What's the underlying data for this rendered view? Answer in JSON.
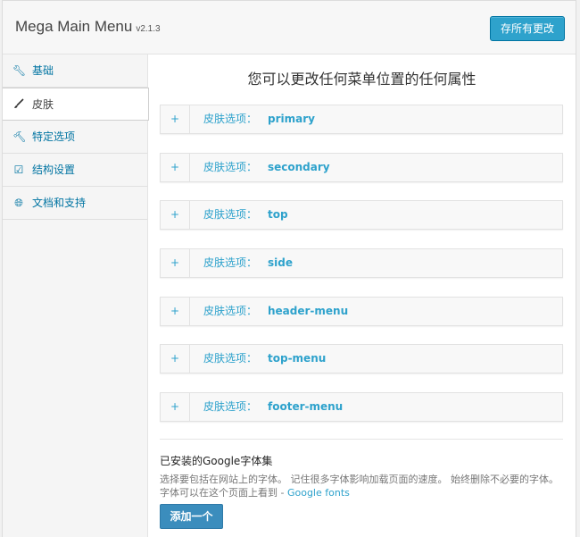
{
  "app": {
    "title": "Mega Main Menu",
    "version": "v2.1.3",
    "save_label": "存所有更改"
  },
  "sidebar": {
    "items": [
      {
        "label": "基础",
        "icon": "wrench-icon"
      },
      {
        "label": "皮肤",
        "icon": "brush-icon",
        "active": true
      },
      {
        "label": "特定选项",
        "icon": "hammer-icon"
      },
      {
        "label": "结构设置",
        "icon": "checkbox-icon"
      },
      {
        "label": "文档和支持",
        "icon": "globe-icon"
      }
    ]
  },
  "main": {
    "heading": "您可以更改任何菜单位置的任何属性",
    "skin_label": "皮肤选项：",
    "expand_symbol": "+",
    "skins": [
      "primary",
      "secondary",
      "top",
      "side",
      "header-menu",
      "top-menu",
      "footer-menu"
    ]
  },
  "fonts": {
    "title": "已安装的Google字体集",
    "description": "选择要包括在网站上的字体。 记住很多字体影响加载页面的速度。 始终删除不必要的字体。 字体可以在这个页面上看到 -",
    "link_text": "Google fonts",
    "add_label": "添加一个"
  },
  "colors": {
    "accent": "#2ea2cc",
    "button_primary": "#2ea2cc",
    "button_add": "#3b8dbd"
  }
}
